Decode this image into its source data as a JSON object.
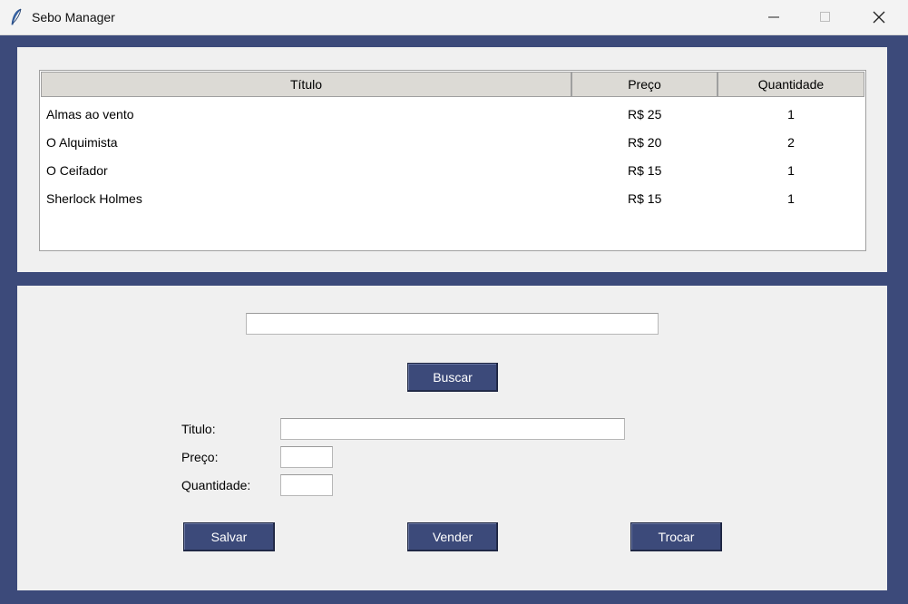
{
  "window": {
    "title": "Sebo Manager",
    "icons": {
      "app": "feather-icon",
      "minimize": "minimize-icon",
      "maximize": "maximize-icon",
      "close": "close-icon"
    }
  },
  "table": {
    "headers": {
      "title": "Título",
      "price": "Preço",
      "quantity": "Quantidade"
    },
    "rows": [
      {
        "title": "Almas ao vento",
        "price": "R$ 25",
        "quantity": "1"
      },
      {
        "title": "O Alquimista",
        "price": "R$ 20",
        "quantity": "2"
      },
      {
        "title": "O Ceifador",
        "price": "R$ 15",
        "quantity": "1"
      },
      {
        "title": "Sherlock Holmes",
        "price": "R$ 15",
        "quantity": "1"
      }
    ]
  },
  "search": {
    "value": "",
    "button_label": "Buscar"
  },
  "form": {
    "title_label": "Titulo:",
    "title_value": "",
    "price_label": "Preço:",
    "price_value": "",
    "quantity_label": "Quantidade:",
    "quantity_value": ""
  },
  "actions": {
    "save_label": "Salvar",
    "sell_label": "Vender",
    "trade_label": "Trocar"
  },
  "colors": {
    "accent": "#3c4a7a",
    "panel": "#f0f0f0",
    "header": "#dcdad5"
  }
}
